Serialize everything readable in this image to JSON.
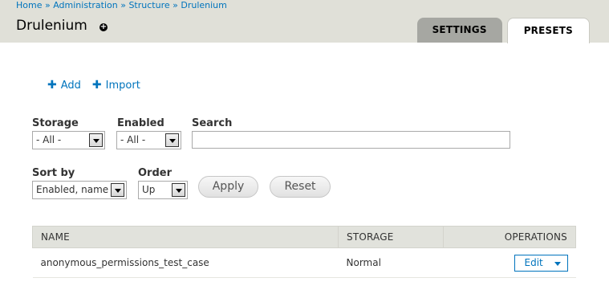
{
  "breadcrumb": [
    {
      "label": "Home"
    },
    {
      "label": "Administration"
    },
    {
      "label": "Structure"
    },
    {
      "label": "Drulenium"
    }
  ],
  "breadcrumb_separator": "»",
  "page_title": "Drulenium",
  "shortcut_glyph": "+",
  "tabs": [
    {
      "label": "SETTINGS"
    },
    {
      "label": "PRESETS"
    }
  ],
  "actions": {
    "add_label": "Add",
    "import_label": "Import",
    "plus_glyph": "✚"
  },
  "filters": {
    "storage_label": "Storage",
    "storage_value": "- All -",
    "enabled_label": "Enabled",
    "enabled_value": "- All -",
    "search_label": "Search",
    "search_value": "",
    "sort_label": "Sort by",
    "sort_value": "Enabled, name",
    "order_label": "Order",
    "order_value": "Up",
    "apply_label": "Apply",
    "reset_label": "Reset"
  },
  "table": {
    "headers": {
      "name": "NAME",
      "storage": "STORAGE",
      "operations": "OPERATIONS"
    },
    "rows": [
      {
        "name": "anonymous_permissions_test_case",
        "storage": "Normal",
        "operation": "Edit"
      }
    ]
  },
  "colors": {
    "link": "#0074bd",
    "header_bg": "#e0e0d8",
    "inactive_tab": "#a6a7a2"
  }
}
